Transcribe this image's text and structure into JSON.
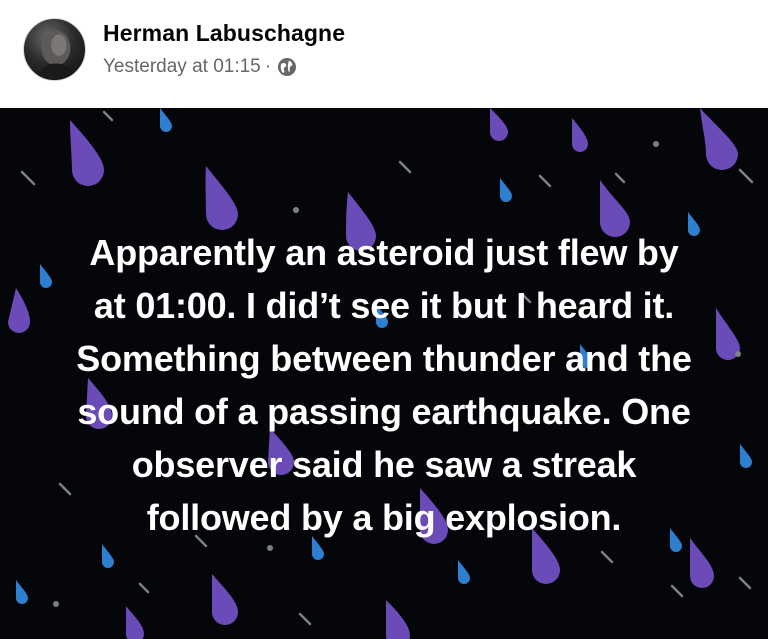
{
  "post": {
    "author_name": "Herman Labuschagne",
    "timestamp": "Yesterday at 01:15",
    "separator": "·",
    "audience_icon": "globe-icon",
    "body_lines": [
      "Apparently an asteroid just flew by",
      "at 01:00. I did’t see it but I heard it.",
      "Something between thunder and the",
      "sound of a passing earthquake. One",
      "observer said he saw a streak",
      "followed by a big explosion."
    ],
    "background_style": "rain-drops",
    "colors": {
      "background": "#05060a",
      "drop_purple": "#6b4bb8",
      "drop_blue": "#2f7fd1",
      "drop_gray": "#7d7f86",
      "text": "#ffffff"
    }
  }
}
